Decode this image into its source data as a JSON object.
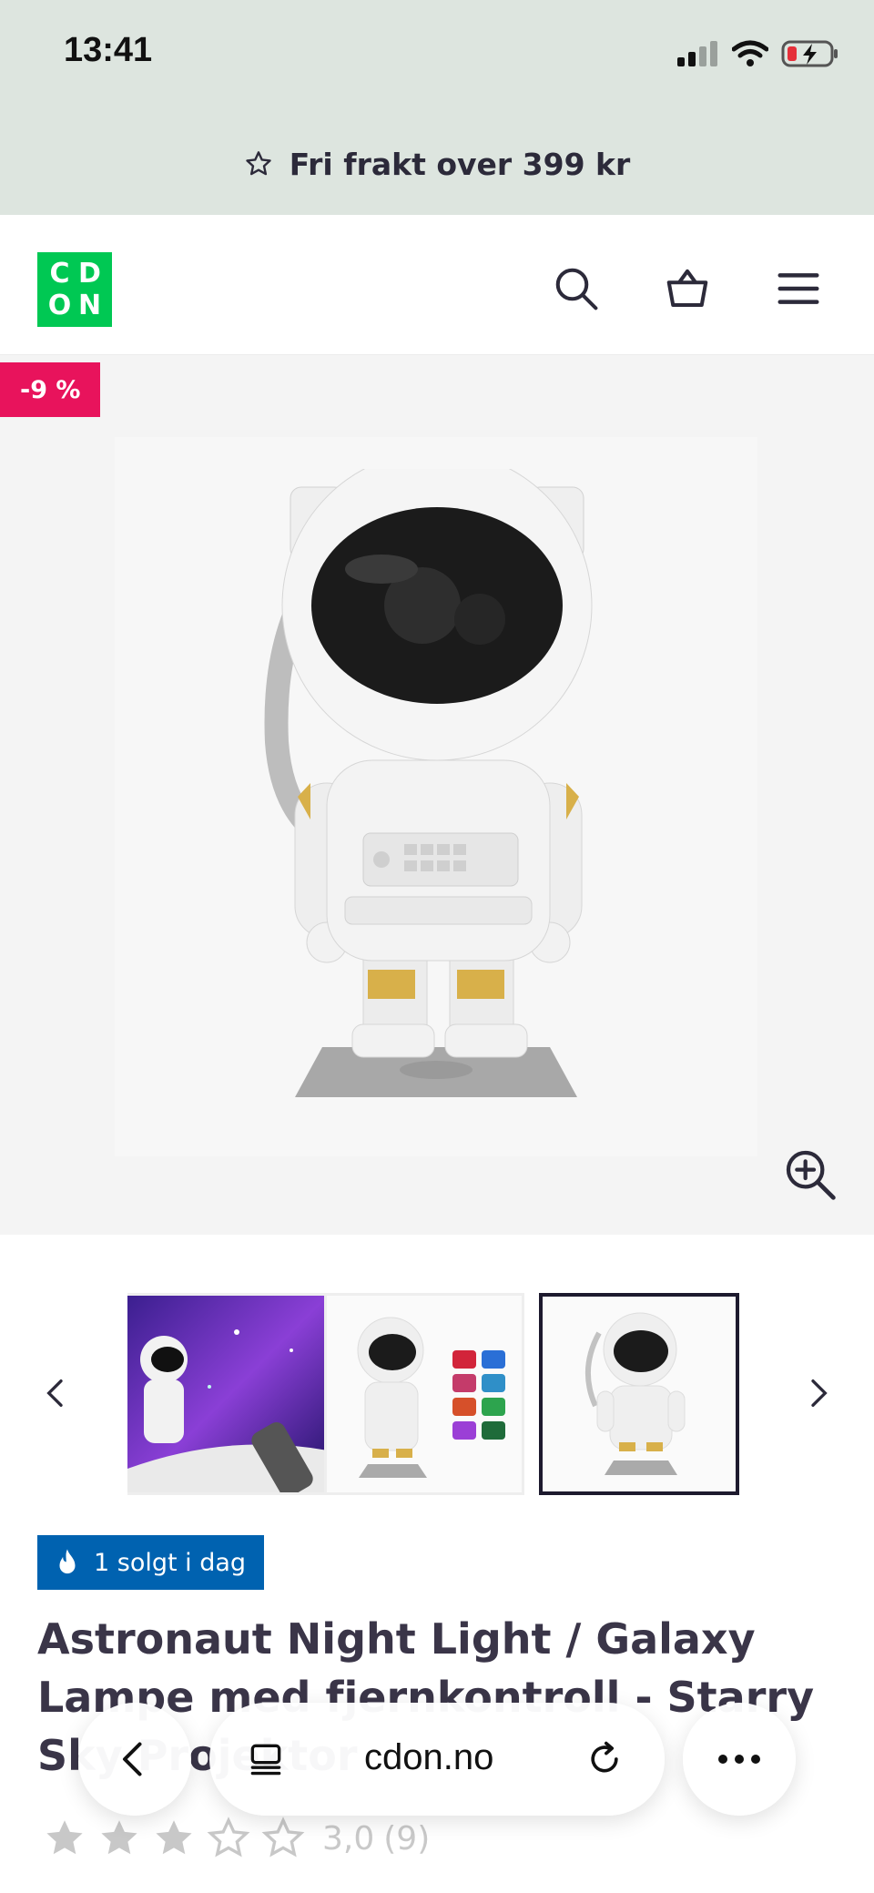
{
  "status_bar": {
    "time": "13:41"
  },
  "promo": {
    "text": "Fri frakt over 399 kr",
    "icon": "star-outline-icon"
  },
  "header": {
    "logo": {
      "letters": [
        "C",
        "D",
        "O",
        "N"
      ],
      "color": "#00c853"
    },
    "icons": [
      "search-icon",
      "basket-icon",
      "menu-icon"
    ]
  },
  "product": {
    "discount_badge": "-9 %",
    "discount_color": "#e8135c",
    "image_alt": "astronaut-lamp",
    "zoom_icon": "zoom-in-icon",
    "thumbnails": [
      {
        "name": "thumbnail-galaxy-projection",
        "active": false
      },
      {
        "name": "thumbnail-color-modes",
        "active": false
      },
      {
        "name": "thumbnail-astronaut",
        "active": true
      }
    ],
    "sold_badge": "1 solgt i dag",
    "sold_badge_color": "#0062b0",
    "title": "Astronaut Night Light / Galaxy Lampe med fjernkontroll - Starry Sky Projektor",
    "rating": {
      "stars": 3,
      "max_stars": 5,
      "value": "3,0",
      "count": "(9)"
    }
  },
  "browser_bar": {
    "url": "cdon.no",
    "icons": [
      "back-icon",
      "tabs-icon",
      "reload-icon",
      "more-icon"
    ]
  }
}
